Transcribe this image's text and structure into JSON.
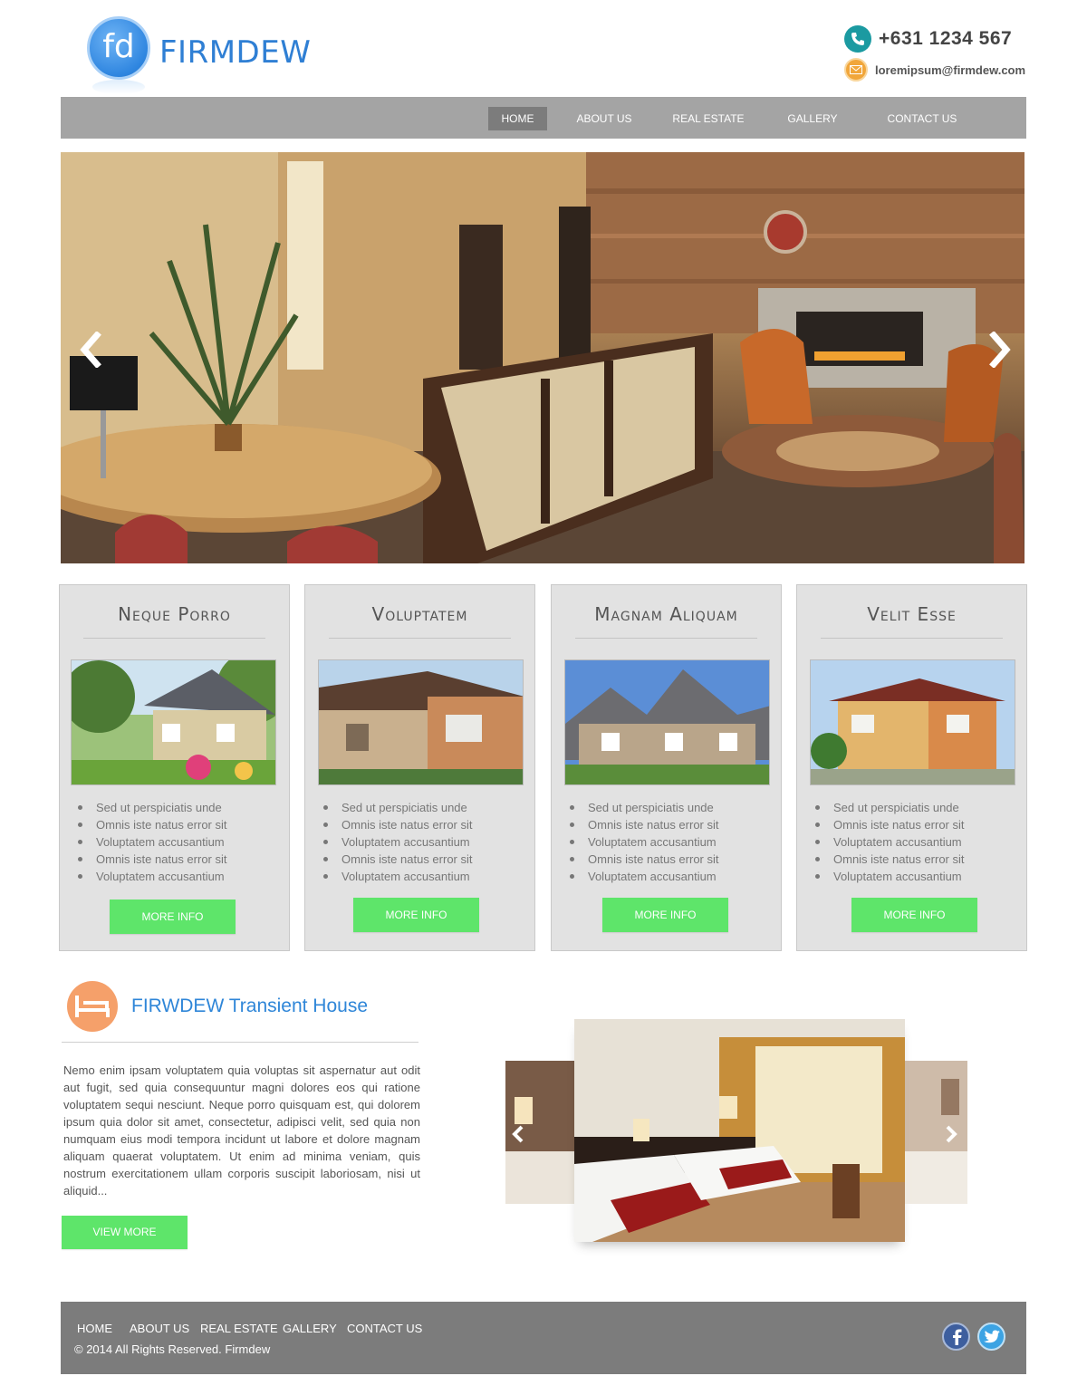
{
  "brand": {
    "logo_mark": "fd",
    "name": "FIRMDEW"
  },
  "contact": {
    "phone": "+631 1234 567",
    "email": "loremipsum@firmdew.com"
  },
  "nav": {
    "items": [
      {
        "label": "HOME",
        "active": true
      },
      {
        "label": "ABOUT US"
      },
      {
        "label": "REAL ESTATE"
      },
      {
        "label": "GALLERY"
      },
      {
        "label": "CONTACT US"
      }
    ]
  },
  "hero": {
    "prev_icon": "chevron-left-icon",
    "next_icon": "chevron-right-icon"
  },
  "cards": [
    {
      "title": "Neque Porro",
      "items": [
        "Sed ut perspiciatis unde",
        "Omnis iste natus error sit",
        "Voluptatem accusantium",
        "Omnis iste natus error sit",
        "Voluptatem accusantium"
      ],
      "button": "MORE INFO"
    },
    {
      "title": "Voluptatem",
      "items": [
        "Sed ut perspiciatis unde",
        "Omnis iste natus error sit",
        "Voluptatem accusantium",
        "Omnis iste natus error sit",
        "Voluptatem accusantium"
      ],
      "button": "MORE INFO"
    },
    {
      "title": "Magnam Aliquam",
      "items": [
        "Sed ut perspiciatis unde",
        "Omnis iste natus error sit",
        "Voluptatem accusantium",
        "Omnis iste natus error sit",
        "Voluptatem accusantium"
      ],
      "button": "MORE INFO"
    },
    {
      "title": "Velit Esse",
      "items": [
        "Sed ut perspiciatis unde",
        "Omnis iste natus error sit",
        "Voluptatem accusantium",
        "Omnis iste natus error sit",
        "Voluptatem accusantium"
      ],
      "button": "MORE INFO"
    }
  ],
  "transient": {
    "title": "FIRWDEW Transient House",
    "body": "Nemo enim ipsam voluptatem quia voluptas sit aspernatur aut odit aut fugit, sed quia consequuntur magni dolores eos qui ratione voluptatem sequi nesciunt. Neque porro quisquam est, qui dolorem ipsum quia dolor sit amet, consectetur, adipisci velit, sed quia non numquam eius modi tempora incidunt ut labore et dolore magnam aliquam quaerat voluptatem. Ut enim ad minima veniam, quis nostrum exercitationem ullam corporis suscipit laboriosam, nisi ut aliquid...",
    "button": "VIEW MORE"
  },
  "footer": {
    "links": [
      "HOME",
      "ABOUT US",
      "REAL ESTATE",
      "GALLERY",
      "CONTACT US"
    ],
    "copyright": "© 2014 All Rights Reserved. Firmdew"
  },
  "colors": {
    "accent_blue": "#2f86d8",
    "button_green": "#5ee56a",
    "nav_gray": "#a4a4a4",
    "footer_gray": "#7c7c7c"
  }
}
